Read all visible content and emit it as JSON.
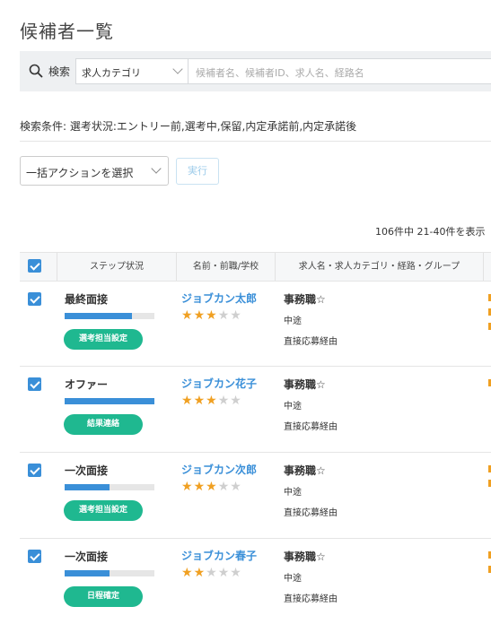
{
  "page": {
    "title": "候補者一覧"
  },
  "search": {
    "label": "検索",
    "category_value": "求人カテゴリ",
    "keyword_placeholder": "候補者名、候補者ID、求人名、経路名"
  },
  "conditions": {
    "text": "検索条件:  選考状況:エントリー前,選考中,保留,内定承諾前,内定承諾後"
  },
  "bulk": {
    "select_value": "一括アクションを選択",
    "run_label": "実行"
  },
  "count": {
    "text": "106件中 21-40件を表示"
  },
  "table": {
    "headers": {
      "step": "ステップ状況",
      "name": "名前・前職/学校",
      "job": "求人名・求人カテゴリ・経路・グループ"
    },
    "rows": [
      {
        "step": "最終面接",
        "progress": 0.75,
        "action": "選考担当設定",
        "name": "ジョブカン太郎",
        "rating": 3,
        "job_name": "事務職☆",
        "job_category": "中途",
        "route": "直接応募経由"
      },
      {
        "step": "オファー",
        "progress": 1.0,
        "action": "結果連絡",
        "name": "ジョブカン花子",
        "rating": 3,
        "job_name": "事務職☆",
        "job_category": "中途",
        "route": "直接応募経由"
      },
      {
        "step": "一次面接",
        "progress": 0.5,
        "action": "選考担当設定",
        "name": "ジョブカン次郎",
        "rating": 3,
        "job_name": "事務職☆",
        "job_category": "中途",
        "route": "直接応募経由"
      },
      {
        "step": "一次面接",
        "progress": 0.5,
        "action": "日程確定",
        "name": "ジョブカン春子",
        "rating": 2,
        "job_name": "事務職☆",
        "job_category": "中途",
        "route": "直接応募経由"
      }
    ]
  },
  "colors": {
    "accent": "#3a8fd8",
    "action_button": "#1fb890",
    "star": "#f0a022"
  }
}
